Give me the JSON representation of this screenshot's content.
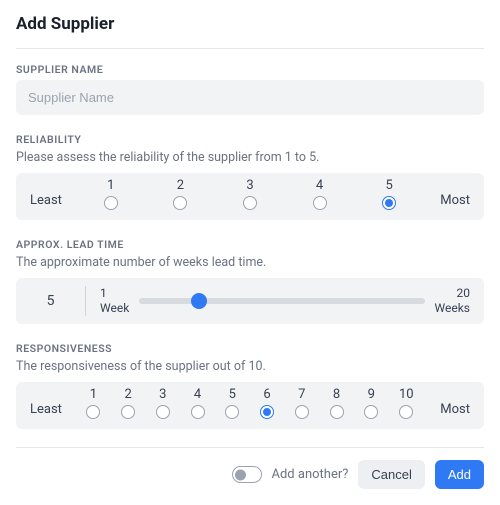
{
  "title": "Add Supplier",
  "supplierName": {
    "label": "SUPPLIER NAME",
    "placeholder": "Supplier Name",
    "value": ""
  },
  "reliability": {
    "label": "RELIABILITY",
    "desc": "Please assess the reliability of the supplier from 1 to 5.",
    "leastLabel": "Least",
    "mostLabel": "Most",
    "options": [
      "1",
      "2",
      "3",
      "4",
      "5"
    ],
    "selected": 5
  },
  "leadTime": {
    "label": "APPROX. LEAD TIME",
    "desc": "The approximate number of weeks lead time.",
    "value": "5",
    "min": 1,
    "max": 20,
    "minLabelNum": "1",
    "minLabelUnit": "Week",
    "maxLabelNum": "20",
    "maxLabelUnit": "Weeks"
  },
  "responsiveness": {
    "label": "RESPONSIVENESS",
    "desc": "The responsiveness of the supplier out of 10.",
    "leastLabel": "Least",
    "mostLabel": "Most",
    "options": [
      "1",
      "2",
      "3",
      "4",
      "5",
      "6",
      "7",
      "8",
      "9",
      "10"
    ],
    "selected": 6
  },
  "footer": {
    "addAnotherLabel": "Add another?",
    "addAnother": false,
    "cancel": "Cancel",
    "add": "Add"
  }
}
